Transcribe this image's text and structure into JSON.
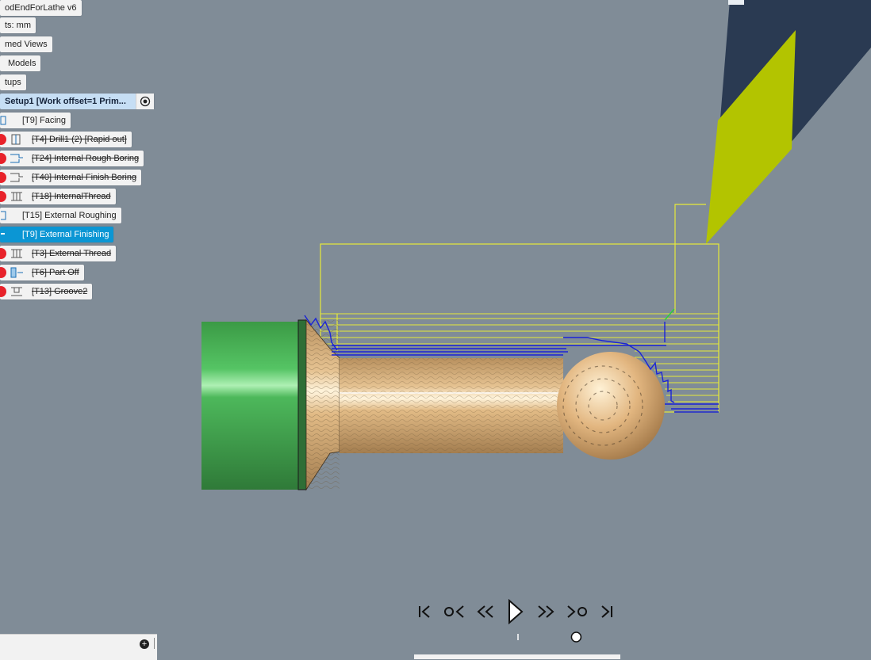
{
  "browser": {
    "document_title": "odEndForLathe v6",
    "units": "ts: mm",
    "named_views": "med Views",
    "models": "Models",
    "setups": "tups",
    "setup1": "Setup1 [Work offset=1 Prim...",
    "operations": [
      {
        "label": "[T9] Facing",
        "struck": false,
        "selected": false,
        "has_dot": false
      },
      {
        "label": "[T4] Drill1 (2) [Rapid out]",
        "struck": true,
        "selected": false,
        "has_dot": true
      },
      {
        "label": "[T24] Internal Rough Boring",
        "struck": true,
        "selected": false,
        "has_dot": true
      },
      {
        "label": "[T40] Internal Finish Boring",
        "struck": true,
        "selected": false,
        "has_dot": true
      },
      {
        "label": "[T18] InternalThread",
        "struck": true,
        "selected": false,
        "has_dot": true
      },
      {
        "label": "[T15] External Roughing",
        "struck": false,
        "selected": false,
        "has_dot": false
      },
      {
        "label": "[T9] External Finishing",
        "struck": false,
        "selected": true,
        "has_dot": false
      },
      {
        "label": "[T3] External Thread",
        "struck": true,
        "selected": false,
        "has_dot": true
      },
      {
        "label": "[T6] Part Off",
        "struck": true,
        "selected": false,
        "has_dot": true
      },
      {
        "label": "[T13] Groove2",
        "struck": true,
        "selected": false,
        "has_dot": true
      }
    ]
  },
  "playback": {
    "buttons": [
      "go-to-start",
      "previous-operation",
      "step-back",
      "play",
      "step-forward",
      "next-operation",
      "go-to-end"
    ],
    "progress": 0.74
  },
  "colors": {
    "viewport_bg": "#808c97",
    "stock_green": "#3fae4e",
    "part_wood": "#d9b27e",
    "toolpath_blue": "#1a23d6",
    "toolpath_yellow": "#e6ea3a",
    "tool_insert": "#b3c400",
    "tool_holder": "#2a3a52",
    "selected_item": "#0b96d4",
    "suppressed_dot": "#e8222a"
  }
}
